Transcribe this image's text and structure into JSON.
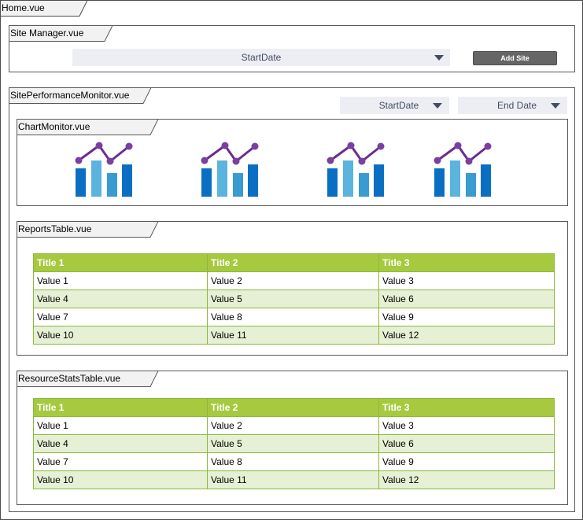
{
  "home": {
    "title": "Home.vue"
  },
  "site_manager": {
    "title": "Site Manager.vue",
    "start_date": "StartDate",
    "add_site": "Add Site"
  },
  "site_performance": {
    "title": "SitePerformanceMonitor.vue",
    "start_date": "StartDate",
    "end_date": "End Date"
  },
  "chart_monitor": {
    "title": "ChartMonitor.vue",
    "icons": [
      "bar-line-chart-icon",
      "bar-line-chart-icon",
      "bar-line-chart-icon",
      "bar-line-chart-icon"
    ],
    "colors": {
      "bar_dark": "#0a6fc2",
      "bar_light": "#5ab4dd",
      "bar_mid": "#3a9bd0",
      "line": "#6b2d8a",
      "dot": "#7b3fa0"
    }
  },
  "reports_table": {
    "title": "ReportsTable.vue",
    "headers": [
      "Title 1",
      "Title 2",
      "Title 3"
    ],
    "rows": [
      [
        "Value 1",
        "Value 2",
        "Value 3"
      ],
      [
        "Value 4",
        "Value 5",
        "Value 6"
      ],
      [
        "Value 7",
        "Value 8",
        "Value 9"
      ],
      [
        "Value 10",
        "Value 11",
        "Value 12"
      ]
    ]
  },
  "resource_stats_table": {
    "title": "ResourceStatsTable.vue",
    "headers": [
      "Title 1",
      "Title 2",
      "Title 3"
    ],
    "rows": [
      [
        "Value 1",
        "Value 2",
        "Value 3"
      ],
      [
        "Value 4",
        "Value 5",
        "Value 6"
      ],
      [
        "Value 7",
        "Value 8",
        "Value 9"
      ],
      [
        "Value 10",
        "Value 11",
        "Value 12"
      ]
    ]
  },
  "theme": {
    "header_green": "#a6c93f",
    "row_alt_green": "#e6f0d5",
    "tab_fill": "#f2f2f2",
    "dropdown_bg": "#eceef3",
    "button_bg": "#666666"
  }
}
